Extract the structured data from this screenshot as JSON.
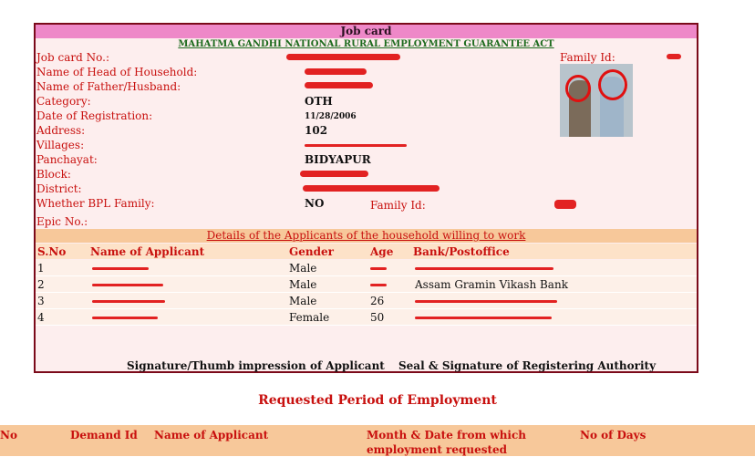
{
  "card": {
    "title": "Job card",
    "act": "MAHATMA GANDHI NATIONAL RURAL EMPLOYMENT GUARANTEE ACT",
    "fields": [
      {
        "label": "Job card No.:",
        "value": "",
        "redacted": true
      },
      {
        "label": "Name of Head of Household:",
        "value": "",
        "redacted": true
      },
      {
        "label": "Name of Father/Husband:",
        "value": "",
        "redacted": true
      },
      {
        "label": "Category:",
        "value": "OTH"
      },
      {
        "label": "Date of Registration:",
        "value": "11/28/2006"
      },
      {
        "label": "Address:",
        "value": "102"
      },
      {
        "label": "Villages:",
        "value": "",
        "redacted": true
      },
      {
        "label": "Panchayat:",
        "value": "BIDYAPUR"
      },
      {
        "label": "Block:",
        "value": "",
        "redacted": true
      },
      {
        "label": "District:",
        "value": "",
        "redacted": true
      },
      {
        "label": "Whether BPL Family:",
        "value": "NO"
      },
      {
        "label": "Epic No.:",
        "value": ""
      }
    ],
    "family_id_label": "Family Id:",
    "family_id_label_2": "Family Id:",
    "details_heading": "Details of the Applicants of the household willing to work",
    "table": {
      "headers": [
        "S.No",
        "Name of Applicant",
        "Gender",
        "Age",
        "Bank/Postoffice"
      ],
      "rows": [
        {
          "sno": "1",
          "gender": "Male",
          "age": "",
          "bank": ""
        },
        {
          "sno": "2",
          "gender": "Male",
          "age": "",
          "bank": "Assam Gramin Vikash Bank"
        },
        {
          "sno": "3",
          "gender": "Male",
          "age": "26",
          "bank": ""
        },
        {
          "sno": "4",
          "gender": "Female",
          "age": "50",
          "bank": ""
        }
      ]
    },
    "signature_applicant": "Signature/Thumb impression of Applicant",
    "signature_authority": "Seal & Signature of Registering Authority"
  },
  "employment": {
    "heading": "Requested Period of Employment",
    "columns": [
      "No",
      "Demand Id",
      "Name of Applicant",
      "Month & Date from which employment requested",
      "No of Days"
    ]
  },
  "colors": {
    "accent": "#c8100e",
    "border": "#7b0a1a",
    "title_bar": "#ee88c8",
    "header_bar": "#f7c89a"
  }
}
